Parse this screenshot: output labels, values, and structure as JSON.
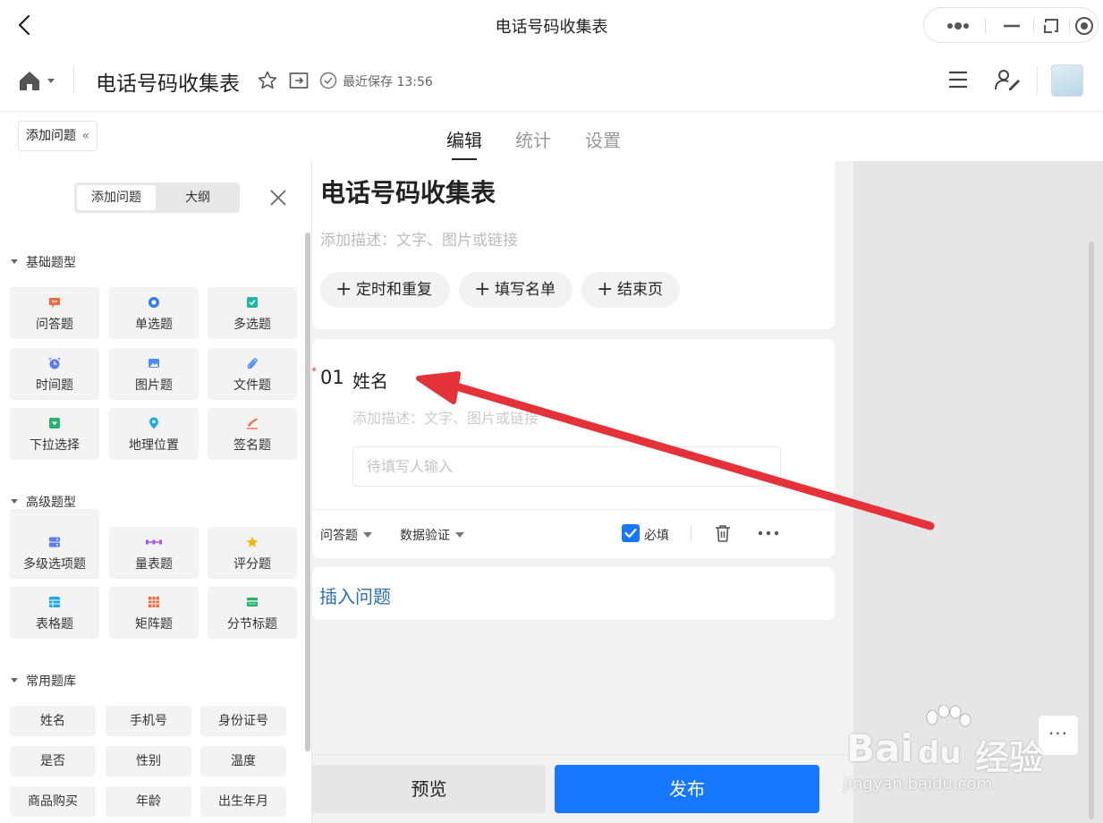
{
  "window": {
    "title": "电话号码收集表"
  },
  "toolbar": {
    "doc_title": "电话号码收集表",
    "saved_status": "最近保存 13:56"
  },
  "tabs": {
    "add_question_toggle": "添加问题",
    "toggle_chevron": "«",
    "edit": "编辑",
    "stats": "统计",
    "settings": "设置"
  },
  "panel": {
    "seg_add": "添加问题",
    "seg_outline": "大纲",
    "basic_title": "基础题型",
    "basic": [
      {
        "label": "问答题",
        "icon": "comment-icon",
        "color": "#f26b3a"
      },
      {
        "label": "单选题",
        "icon": "radio-icon",
        "color": "#2f7cf6"
      },
      {
        "label": "多选题",
        "icon": "checkbox-icon",
        "color": "#1fb8a6"
      },
      {
        "label": "时间题",
        "icon": "alarm-clock-icon",
        "color": "#5b7cf6"
      },
      {
        "label": "图片题",
        "icon": "image-icon",
        "color": "#4b8cf6"
      },
      {
        "label": "文件题",
        "icon": "paperclip-icon",
        "color": "#4b8cf6"
      },
      {
        "label": "下拉选择",
        "icon": "dropdown-icon",
        "color": "#27b26d"
      },
      {
        "label": "地理位置",
        "icon": "location-pin-icon",
        "color": "#19a9e6"
      },
      {
        "label": "签名题",
        "icon": "signature-icon",
        "color": "#f26b3a"
      }
    ],
    "advanced_title": "高级题型",
    "advanced": [
      {
        "label": "多级选项题",
        "icon": "cascade-icon",
        "color": "#5b7cf6"
      },
      {
        "label": "量表题",
        "icon": "scale-icon",
        "color": "#a55bf0"
      },
      {
        "label": "评分题",
        "icon": "star-icon",
        "color": "#f5b800"
      },
      {
        "label": "表格题",
        "icon": "table-icon",
        "color": "#19a9e6"
      },
      {
        "label": "矩阵题",
        "icon": "matrix-icon",
        "color": "#f26b3a"
      },
      {
        "label": "分节标题",
        "icon": "section-icon",
        "color": "#27b26d"
      }
    ],
    "library_title": "常用题库",
    "library": [
      "姓名",
      "手机号",
      "身份证号",
      "是否",
      "性别",
      "温度",
      "商品购买",
      "年龄",
      "出生年月"
    ]
  },
  "form": {
    "title": "电话号码收集表",
    "description_placeholder": "添加描述：文字、图片或链接",
    "pills": [
      "定时和重复",
      "填写名单",
      "结束页"
    ],
    "question": {
      "required_mark": "*",
      "number": "01",
      "title": "姓名",
      "description_placeholder": "添加描述：文字、图片或链接",
      "input_placeholder": "待填写人输入",
      "type": "问答题",
      "validation": "数据验证",
      "required_label": "必填",
      "required_checked": true
    },
    "insert_question": "插入问题"
  },
  "footer": {
    "preview": "预览",
    "publish": "发布"
  },
  "floating": {
    "more": "···"
  },
  "watermark": {
    "brand": "Bai",
    "brand2": "du",
    "cn": "经验",
    "url": "jingyan.baidu.com"
  },
  "colors": {
    "accent": "#1677ff",
    "link": "#2c6fb7",
    "annotation_arrow": "#e53238"
  }
}
